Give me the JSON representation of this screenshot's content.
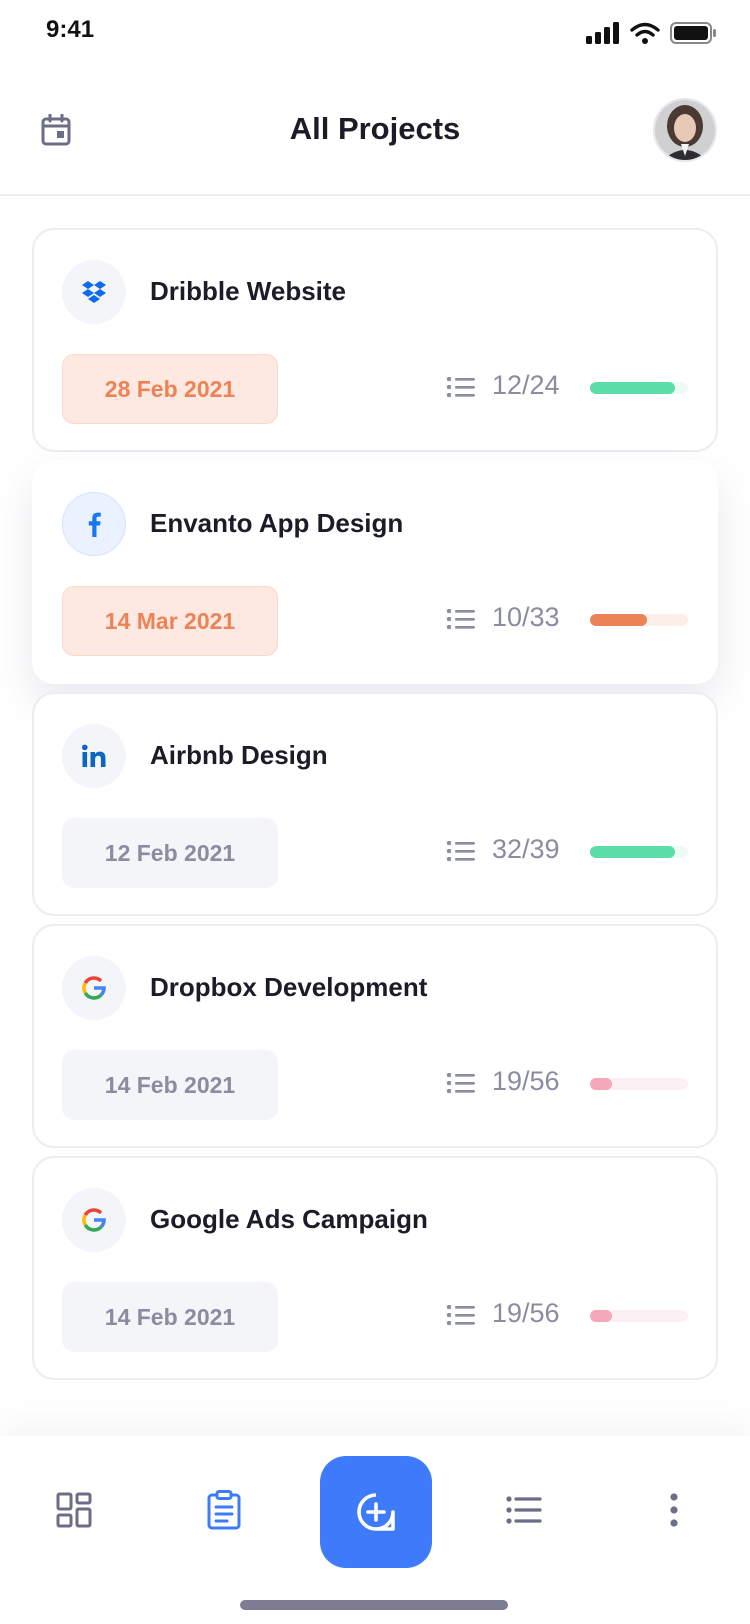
{
  "status_bar": {
    "time": "9:41"
  },
  "header": {
    "title": "All Projects"
  },
  "projects": [
    {
      "title": "Dribble Website",
      "logo": "dropbox-icon",
      "date": "28 Feb 2021",
      "tasks": "12/24",
      "progress": 0.87,
      "bar_color": "#5cdca6",
      "track_color": "#eefbf4",
      "highlighted": false,
      "due_soon": true
    },
    {
      "title": "Envanto App Design",
      "logo": "facebook-icon",
      "date": "14 Mar 2021",
      "tasks": "10/33",
      "progress": 0.58,
      "bar_color": "#ec8357",
      "track_color": "#fdeee8",
      "highlighted": true,
      "due_soon": true
    },
    {
      "title": "Airbnb Design",
      "logo": "linkedin-icon",
      "date": "12 Feb 2021",
      "tasks": "32/39",
      "progress": 0.87,
      "bar_color": "#5cdca6",
      "track_color": "#eefbf4",
      "highlighted": false,
      "due_soon": false
    },
    {
      "title": "Dropbox Development",
      "logo": "google-icon",
      "date": "14 Feb 2021",
      "tasks": "19/56",
      "progress": 0.22,
      "bar_color": "#f6a8b8",
      "track_color": "#fdf0f2",
      "highlighted": false,
      "due_soon": false
    },
    {
      "title": "Google Ads Campaign",
      "logo": "google-icon",
      "date": "14 Feb 2021",
      "tasks": "19/56",
      "progress": 0.22,
      "bar_color": "#f6a8b8",
      "track_color": "#fdf0f2",
      "highlighted": false,
      "due_soon": false
    }
  ],
  "bottom_nav": {
    "items": [
      "dashboard-icon",
      "clipboard-icon",
      "add-icon",
      "list-icon",
      "more-icon"
    ],
    "active": "clipboard-icon",
    "accent": "#3e7bfa"
  },
  "colors": {
    "accent": "#3e7bfa",
    "due": "#ec8357",
    "muted": "#8a8ca0"
  }
}
